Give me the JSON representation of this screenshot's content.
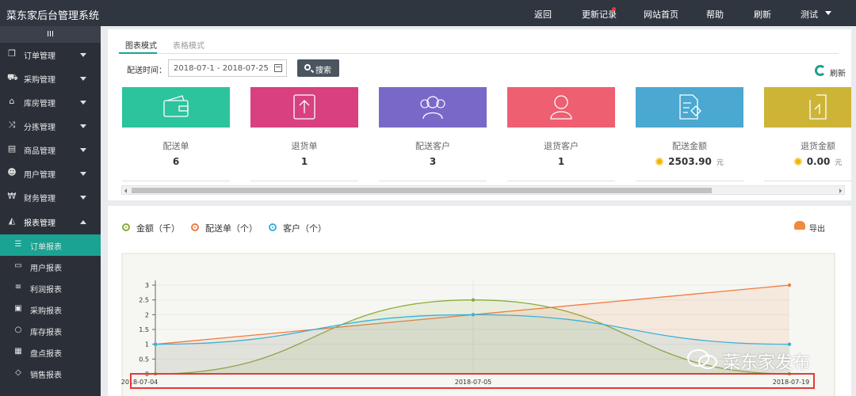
{
  "app": {
    "title": "菜东家后台管理系统"
  },
  "topnav": {
    "back": "返回",
    "updates": "更新记录",
    "homepage": "网站首页",
    "help": "帮助",
    "refresh": "刷新",
    "user": "测试"
  },
  "sidebar": {
    "toggle": "III",
    "items": [
      {
        "label": "订单管理",
        "icon": "copy-icon"
      },
      {
        "label": "采购管理",
        "icon": "cart-icon"
      },
      {
        "label": "库房管理",
        "icon": "warehouse-icon"
      },
      {
        "label": "分拣管理",
        "icon": "shuffle-icon"
      },
      {
        "label": "商品管理",
        "icon": "shop-icon"
      },
      {
        "label": "用户管理",
        "icon": "users-icon"
      },
      {
        "label": "财务管理",
        "icon": "yen-icon"
      },
      {
        "label": "报表管理",
        "icon": "area-chart-icon"
      }
    ],
    "subitems": [
      {
        "label": "订单报表",
        "icon": "list-icon",
        "active": true
      },
      {
        "label": "用户报表",
        "icon": "id-card-icon"
      },
      {
        "label": "利润报表",
        "icon": "sliders-icon"
      },
      {
        "label": "采购报表",
        "icon": "briefcase-icon"
      },
      {
        "label": "库存报表",
        "icon": "circle-icon"
      },
      {
        "label": "盘点报表",
        "icon": "calculator-icon"
      },
      {
        "label": "销售报表",
        "icon": "diamond-icon"
      }
    ]
  },
  "tabs": {
    "chart": "图表模式",
    "table": "表格模式"
  },
  "filter": {
    "label": "配送时间：",
    "date_range": "2018-07-1 - 2018-07-25",
    "search": "搜索",
    "refresh": "刷新"
  },
  "stats": [
    {
      "name": "配送单",
      "value": "6",
      "color": "#2cc49c",
      "icon": "wallet-icon"
    },
    {
      "name": "退货单",
      "value": "1",
      "color": "#d8407f",
      "icon": "upload-icon"
    },
    {
      "name": "配送客户",
      "value": "3",
      "color": "#7a68c9",
      "icon": "group-icon"
    },
    {
      "name": "退货客户",
      "value": "1",
      "color": "#ee5f71",
      "icon": "user-icon"
    },
    {
      "name": "配送金额",
      "value": "2503.90",
      "unit": "元",
      "color": "#4aa8d1",
      "icon": "document-icon"
    },
    {
      "name": "退货金额",
      "value": "0.00",
      "unit": "元",
      "color": "#cdb437",
      "icon": "return-icon"
    }
  ],
  "legend": [
    {
      "label": "金额（千）",
      "color": "#8aab3a"
    },
    {
      "label": "配送单（个）",
      "color": "#f07b3f"
    },
    {
      "label": "客户（个）",
      "color": "#3bb2d6"
    }
  ],
  "export": {
    "label": "导出"
  },
  "watermark": {
    "text": "菜东家发布"
  },
  "chart_data": {
    "type": "line",
    "x": [
      "2018-07-04",
      "2018-07-05",
      "2018-07-19"
    ],
    "ylim": [
      0,
      3
    ],
    "yticks": [
      "0",
      "0.5",
      "1",
      "1.5",
      "2",
      "2.5",
      "3"
    ],
    "series": [
      {
        "name": "金额（千）",
        "values": [
          0,
          2.5,
          0
        ]
      },
      {
        "name": "配送单（个）",
        "values": [
          1,
          2,
          3
        ]
      },
      {
        "name": "客户（个）",
        "values": [
          1,
          2,
          1
        ]
      }
    ],
    "colors": {
      "amount": "#8aab3a",
      "orders": "#f07b3f",
      "customers": "#3bb2d6",
      "highlight": "#e53935"
    },
    "legend_position": "top-left",
    "grid": true
  }
}
